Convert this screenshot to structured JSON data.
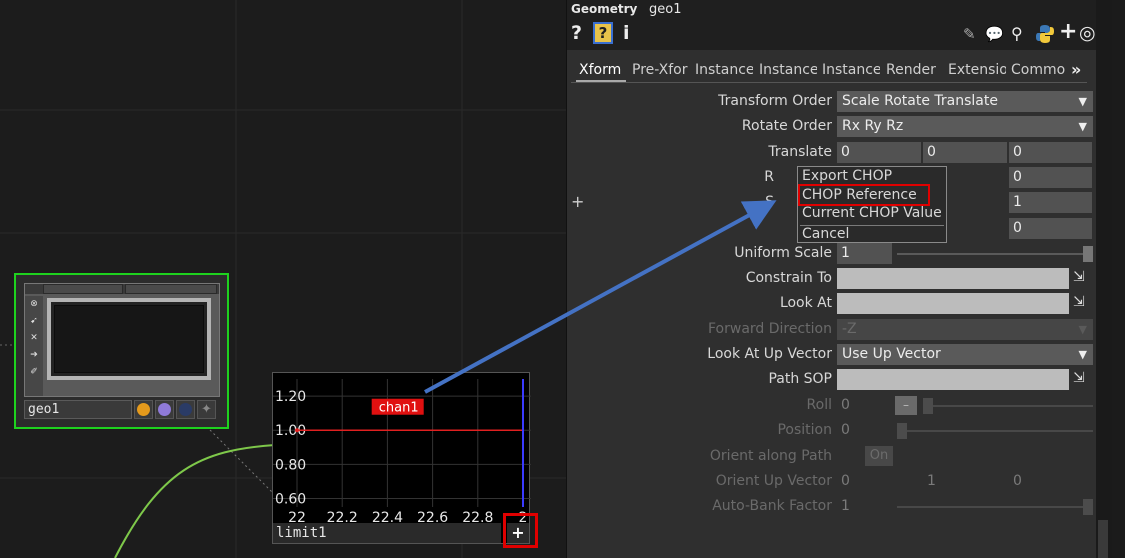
{
  "network": {
    "geo_node": {
      "name": "geo1",
      "tools": [
        "target-icon",
        "pin-icon",
        "x-icon",
        "arrow-icon",
        "brush-icon"
      ],
      "flag_colors": [
        "#e59a1c",
        "#8f7ad9",
        "#2a3b66"
      ],
      "border_color": "#1ed21e"
    },
    "limit_node": {
      "name": "limit1",
      "y_ticks": [
        "1.20",
        "1.00",
        "0.80",
        "0.60"
      ],
      "x_ticks": [
        "22",
        "22.2",
        "22.4",
        "22.6",
        "22.8",
        "2"
      ],
      "channel_label": "chan1",
      "plus_label": "+"
    }
  },
  "chart_data": {
    "type": "line",
    "series": [
      {
        "name": "chan1",
        "x": [
          22.0,
          23.0
        ],
        "y": [
          1.0,
          1.0
        ]
      }
    ],
    "x_ticks": [
      "22",
      "22.2",
      "22.4",
      "22.6",
      "22.8",
      "2"
    ],
    "y_ticks": [
      "1.20",
      "1.00",
      "0.80",
      "0.60"
    ],
    "xlim": [
      22.0,
      23.0
    ],
    "ylim": [
      0.55,
      1.3
    ],
    "grid": true,
    "line_color": "#e02020",
    "cursor_color": "#3a3aff"
  },
  "panel": {
    "type_label": "Geometry",
    "op_name": "geo1",
    "toolbar_left": [
      "?",
      "?",
      "i"
    ],
    "toolbar_right_icons": [
      "pencil-icon",
      "comment-icon",
      "bucket-icon",
      "python-icon",
      "plus-icon",
      "target-icon"
    ],
    "tabs": [
      "Xform",
      "Pre-Xfor",
      "Instance",
      "Instance",
      "Instance",
      "Render",
      "Extensio",
      "Commo"
    ],
    "tabs_more": "»",
    "plus_left": "+",
    "params": {
      "transform_order": {
        "label": "Transform Order",
        "value": "Scale Rotate Translate"
      },
      "rotate_order": {
        "label": "Rotate Order",
        "value": "Rx Ry Rz"
      },
      "translate": {
        "label": "Translate",
        "values": [
          "0",
          "0",
          "0"
        ]
      },
      "rotate": {
        "label": "R",
        "values": [
          "0"
        ]
      },
      "scale": {
        "label": "S",
        "values": [
          "1"
        ]
      },
      "pivot": {
        "values": [
          "0"
        ]
      },
      "uniform_scale": {
        "label": "Uniform Scale",
        "value": "1"
      },
      "constrain_to": {
        "label": "Constrain To"
      },
      "look_at": {
        "label": "Look At"
      },
      "forward_direction": {
        "label": "Forward Direction",
        "value": "-Z"
      },
      "look_at_up_vector": {
        "label": "Look At Up Vector",
        "value": "Use Up Vector"
      },
      "path_sop": {
        "label": "Path SOP"
      },
      "roll": {
        "label": "Roll",
        "value": "0"
      },
      "position": {
        "label": "Position",
        "value": "0"
      },
      "orient_along_path": {
        "label": "Orient along Path",
        "value": "On"
      },
      "orient_up_vector": {
        "label": "Orient Up Vector",
        "values": [
          "0",
          "1",
          "0"
        ]
      },
      "auto_bank_factor": {
        "label": "Auto-Bank Factor",
        "value": "1"
      }
    },
    "context_menu": {
      "items": [
        "Export CHOP",
        "CHOP Reference",
        "Current CHOP Value",
        "Cancel"
      ]
    }
  },
  "colors": {
    "highlight_red": "#e00000",
    "arrow_blue": "#4472c4",
    "wire_green": "#7ec84a"
  }
}
